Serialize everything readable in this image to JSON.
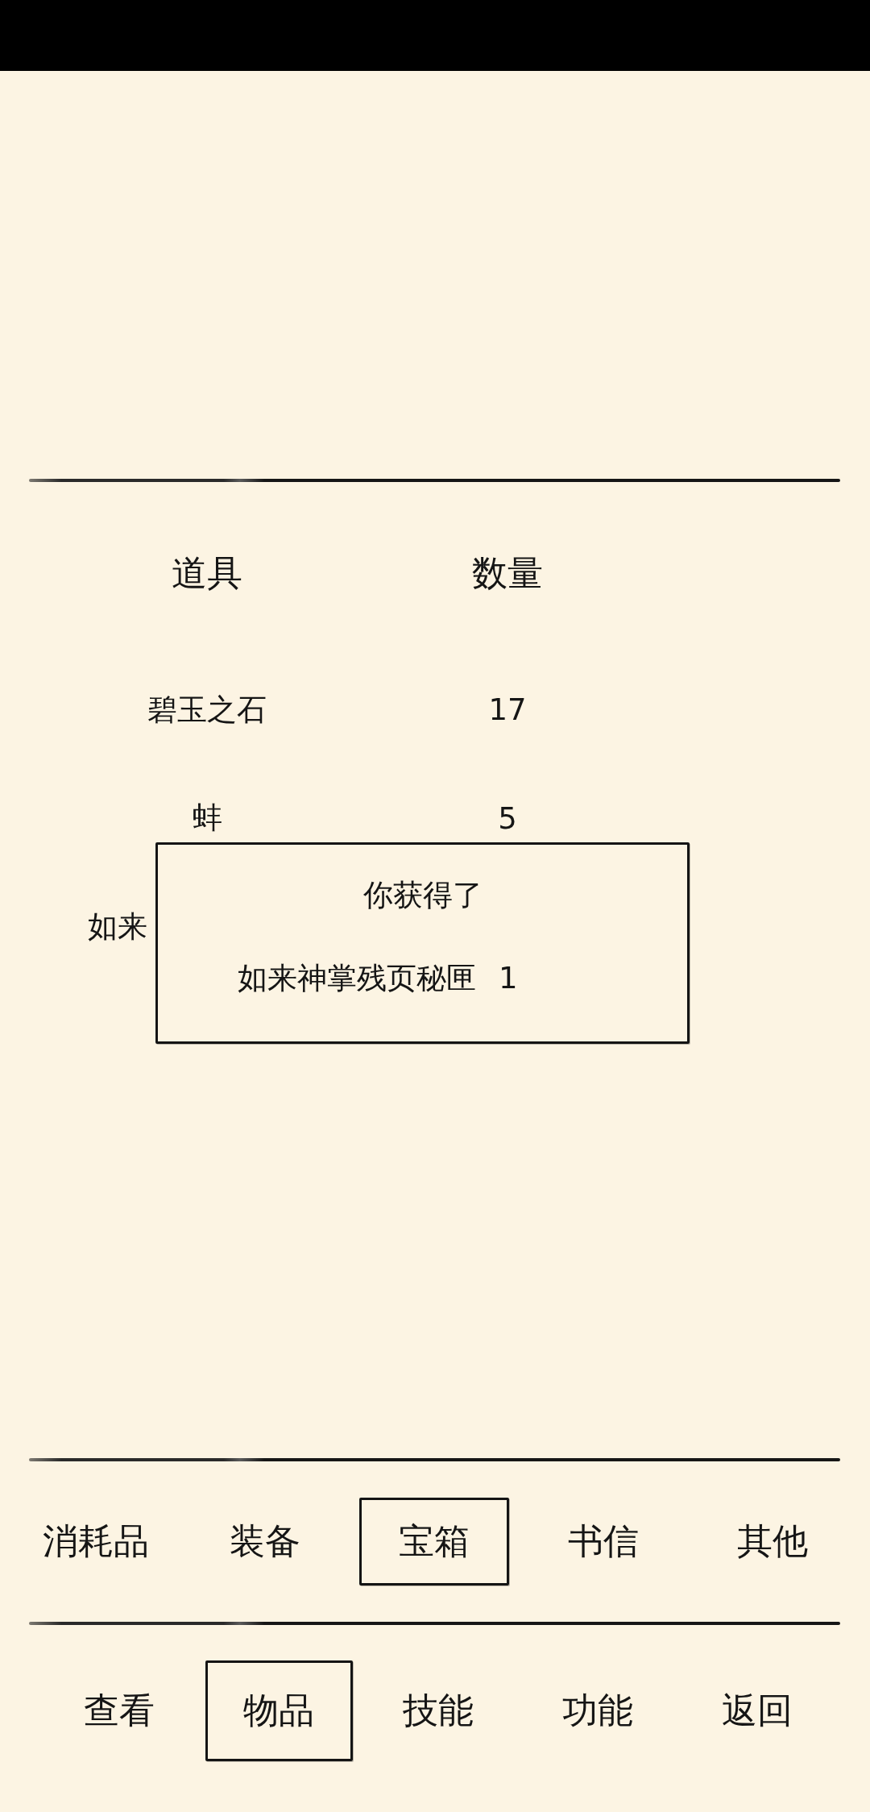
{
  "inventory": {
    "columns": [
      "道具",
      "数量"
    ],
    "rows": [
      {
        "name": "碧玉之石",
        "quantity": "17"
      },
      {
        "name": "蚌",
        "quantity": "5"
      },
      {
        "name": "如来"
      }
    ]
  },
  "reward_popup": {
    "title": "你获得了",
    "item": {
      "name": "如来神掌残页秘匣",
      "quantity": "1"
    }
  },
  "category_tabs": [
    {
      "label": "消耗品",
      "selected": false
    },
    {
      "label": "装备",
      "selected": false
    },
    {
      "label": "宝箱",
      "selected": true
    },
    {
      "label": "书信",
      "selected": false
    },
    {
      "label": "其他",
      "selected": false
    }
  ],
  "nav_tabs": [
    {
      "label": "查看",
      "selected": false
    },
    {
      "label": "物品",
      "selected": true
    },
    {
      "label": "技能",
      "selected": false
    },
    {
      "label": "功能",
      "selected": false
    },
    {
      "label": "返回",
      "selected": false
    }
  ]
}
